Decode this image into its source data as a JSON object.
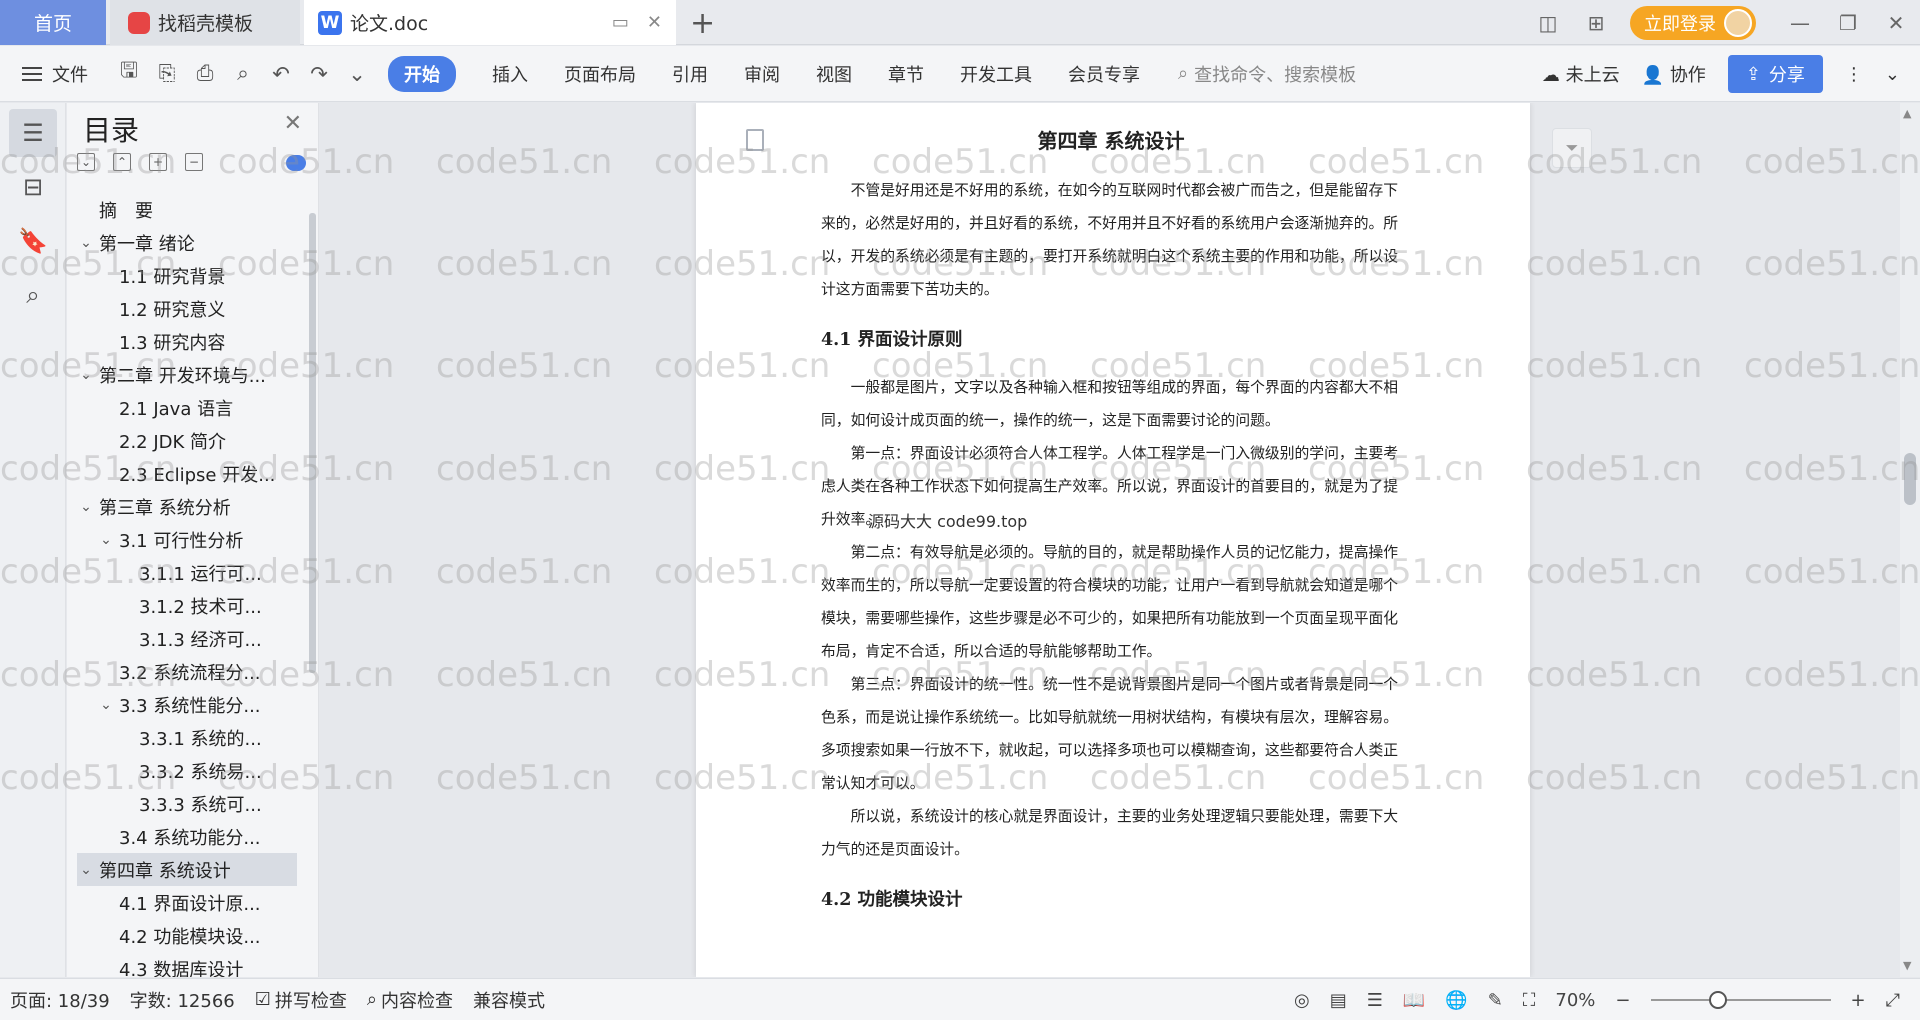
{
  "titlebar": {
    "home_tab": "首页",
    "templates_tab": "找稻壳模板",
    "doc_tab": "论文.doc",
    "login": "立即登录"
  },
  "toolbar": {
    "file": "文件",
    "tabs": [
      "开始",
      "插入",
      "页面布局",
      "引用",
      "审阅",
      "视图",
      "章节",
      "开发工具",
      "会员专享"
    ],
    "search_placeholder": "查找命令、搜索模板",
    "cloud": "未上云",
    "collab": "协作",
    "share": "分享"
  },
  "toc": {
    "title": "目录",
    "items": [
      {
        "label": "摘　要",
        "level": 0,
        "caret": ""
      },
      {
        "label": "第一章 绪论",
        "level": 0,
        "caret": "v"
      },
      {
        "label": "1.1 研究背景",
        "level": 1,
        "caret": ""
      },
      {
        "label": "1.2 研究意义",
        "level": 1,
        "caret": ""
      },
      {
        "label": "1.3 研究内容",
        "level": 1,
        "caret": ""
      },
      {
        "label": "第二章 开发环境与...",
        "level": 0,
        "caret": "v"
      },
      {
        "label": "2.1 Java 语言",
        "level": 1,
        "caret": ""
      },
      {
        "label": "2.2 JDK 简介",
        "level": 1,
        "caret": ""
      },
      {
        "label": "2.3 Eclipse 开发...",
        "level": 1,
        "caret": ""
      },
      {
        "label": "第三章 系统分析",
        "level": 0,
        "caret": "v"
      },
      {
        "label": "3.1 可行性分析",
        "level": 1,
        "caret": "v"
      },
      {
        "label": "3.1.1 运行可...",
        "level": 2,
        "caret": ""
      },
      {
        "label": "3.1.2 技术可...",
        "level": 2,
        "caret": ""
      },
      {
        "label": "3.1.3 经济可...",
        "level": 2,
        "caret": ""
      },
      {
        "label": "3.2 系统流程分...",
        "level": 1,
        "caret": ""
      },
      {
        "label": "3.3 系统性能分...",
        "level": 1,
        "caret": "v"
      },
      {
        "label": "3.3.1 系统的...",
        "level": 2,
        "caret": ""
      },
      {
        "label": "3.3.2 系统易...",
        "level": 2,
        "caret": ""
      },
      {
        "label": "3.3.3 系统可...",
        "level": 2,
        "caret": ""
      },
      {
        "label": "3.4 系统功能分...",
        "level": 1,
        "caret": ""
      },
      {
        "label": "第四章 系统设计",
        "level": 0,
        "caret": "v",
        "selected": true
      },
      {
        "label": "4.1 界面设计原...",
        "level": 1,
        "caret": ""
      },
      {
        "label": "4.2 功能模块设...",
        "level": 1,
        "caret": ""
      },
      {
        "label": "4.3 数据库设计",
        "level": 1,
        "caret": ""
      }
    ]
  },
  "document": {
    "chapter_title": "第四章 系统设计",
    "intro": "不管是好用还是不好用的系统，在如今的互联网时代都会被广而告之，但是能留存下来的，必然是好用的，并且好看的系统，不好用并且不好看的系统用户会逐渐抛弃的。所以，开发的系统必须是有主题的，要打开系统就明白这个系统主要的作用和功能，所以设计这方面需要下苦功夫的。",
    "section1_title": "4.1 界面设计原则",
    "s1_p1": "一般都是图片，文字以及各种输入框和按钮等组成的界面，每个界面的内容都大不相同，如何设计成页面的统一，操作的统一，这是下面需要讨论的问题。",
    "s1_p2": "第一点：界面设计必须符合人体工程学。人体工程学是一门入微级别的学问，主要考虑人类在各种工作状态下如何提高生产效率。所以说，界面设计的首要目的，就是为了提升效率。",
    "s1_p3": "第二点：有效导航是必须的。导航的目的，就是帮助操作人员的记忆能力，提高操作效率而生的，所以导航一定要设置的符合模块的功能，让用户一看到导航就会知道是哪个模块，需要哪些操作，这些步骤是必不可少的，如果把所有功能放到一个页面呈现平面化布局，肯定不合适，所以合适的导航能够帮助工作。",
    "s1_p4": "第三点：界面设计的统一性。统一性不是说背景图片是同一个图片或者背景是同一个色系，而是说让操作系统统一。比如导航就统一用树状结构，有模块有层次，理解容易。多项搜索如果一行放不下，就收起，可以选择多项也可以模糊查询，这些都要符合人类正常认知才可以。",
    "s1_p5": "所以说，系统设计的核心就是界面设计，主要的业务处理逻辑只要能处理，需要下大力气的还是页面设计。",
    "section2_title": "4.2 功能模块设计",
    "overlay": "源码大大 code99.top"
  },
  "statusbar": {
    "page": "页面: 18/39",
    "words": "字数: 12566",
    "spell": "拼写检查",
    "content_check": "内容检查",
    "compat": "兼容模式",
    "zoom": "70%"
  },
  "watermark": "code51.cn"
}
